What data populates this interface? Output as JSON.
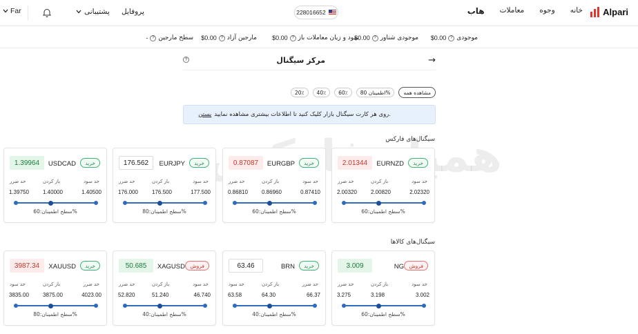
{
  "header": {
    "logo": "Alpari",
    "nav": [
      "هاب",
      "معاملات",
      "وجوه",
      "خانه"
    ],
    "account_number": "228016652",
    "profile": "پروفایل",
    "support": "پشتیبانی",
    "language": "Far"
  },
  "balances": [
    {
      "label": "موجودی",
      "value": "$0.00"
    },
    {
      "label": "موجودی شناور",
      "value": "$0.00"
    },
    {
      "label": "سود و زیان معاملات باز",
      "value": "$0.00"
    },
    {
      "label": "مارجین آزاد",
      "value": "$0.00"
    },
    {
      "label": "سطح مارجین",
      "value": "-"
    }
  ],
  "page": {
    "title": "مرکز سیگنال",
    "filters": [
      "مشاهده همه",
      "اطمینان 80%",
      "60٪",
      "40٪",
      "20٪"
    ],
    "info_text": "روی هر کارت سیگنال بازار کلیک کنید تا اطلاعات بیشتری مشاهده نمایید.",
    "info_link": "بستن",
    "section_forex": "سیگنال‌های فارکس",
    "section_commodities": "سیگنال‌های کالاها",
    "label_tp": "حد سود",
    "label_open": "باز کردن",
    "label_sl": "حد ضرر",
    "watermark": "همیار فارکس"
  },
  "forex_cards": [
    {
      "symbol": "EURNZD",
      "action": "خرید",
      "price": "2.01344",
      "price_state": "down",
      "tp": "2.02320",
      "open": "2.00820",
      "sl": "2.00320",
      "confidence": "سطح اطمینان:60%"
    },
    {
      "symbol": "EURGBP",
      "action": "خرید",
      "price": "0.87087",
      "price_state": "down",
      "tp": "0.87410",
      "open": "0.86960",
      "sl": "0.86810",
      "confidence": "سطح اطمینان:60%"
    },
    {
      "symbol": "EURJPY",
      "action": "خرید",
      "price": "176.562",
      "price_state": "neutral",
      "tp": "177.500",
      "open": "176.500",
      "sl": "176.000",
      "confidence": "سطح اطمینان:80%"
    },
    {
      "symbol": "USDCAD",
      "action": "خرید",
      "price": "1.39964",
      "price_state": "up",
      "tp": "1.40500",
      "open": "1.40000",
      "sl": "1.39750",
      "confidence": "سطح اطمینان:60%"
    }
  ],
  "commodity_cards": [
    {
      "symbol": "NG",
      "action": "فروش",
      "price": "3.009",
      "price_state": "up",
      "tp": "3.002",
      "open": "3.198",
      "sl": "3.275",
      "confidence": "سطح اطمینان:60%",
      "labels": [
        "حد سود",
        "باز کردن",
        "حد ضرر"
      ]
    },
    {
      "symbol": "BRN",
      "action": "خرید",
      "price": "63.46",
      "price_state": "neutral",
      "tp": "66.37",
      "open": "64.30",
      "sl": "63.58",
      "confidence": "سطح اطمینان:40%",
      "labels": [
        "حد ضرر",
        "باز کردن",
        "حد سود"
      ]
    },
    {
      "symbol": "XAGUSD",
      "action": "فروش",
      "price": "50.685",
      "price_state": "up",
      "tp": "46.740",
      "open": "51.240",
      "sl": "52.820",
      "confidence": "سطح اطمینان:40%",
      "labels": [
        "حد سود",
        "باز کردن",
        "حد ضرر"
      ]
    },
    {
      "symbol": "XAUUSD",
      "action": "خرید",
      "price": "3987.34",
      "price_state": "down",
      "tp": "4023.00",
      "open": "3875.00",
      "sl": "3835.00",
      "confidence": "سطح اطمینان:80%",
      "labels": [
        "حد ضرر",
        "باز کردن",
        "حد سود"
      ]
    }
  ],
  "colors": {
    "buy": "#2e8b57",
    "sell": "#c0392b",
    "accent": "#2f6bbd",
    "brand": "#e2352e"
  }
}
